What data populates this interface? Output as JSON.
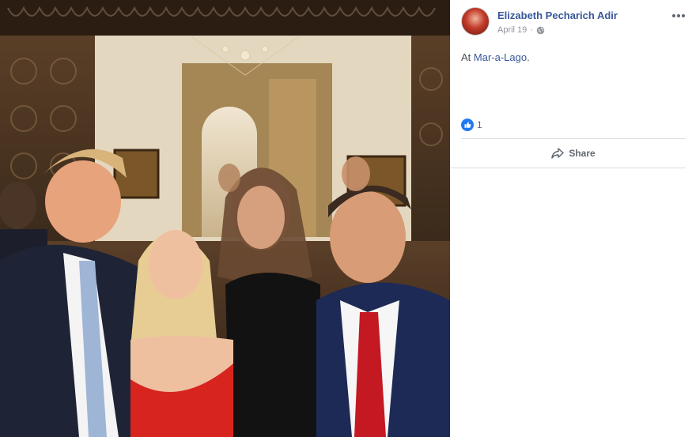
{
  "post": {
    "author": "Elizabeth Pecharich Adir",
    "date": "April 19",
    "separator": "·",
    "privacy_icon": "globe-icon",
    "text_prefix": "At ",
    "place": "Mar-a-Lago",
    "text_suffix": ".",
    "reaction_icon": "like-icon",
    "reaction_count": "1",
    "share_label": "Share"
  },
  "colors": {
    "link": "#385898",
    "meta": "#90949c",
    "like_blue": "#2078f4",
    "divider": "#dadde1"
  }
}
